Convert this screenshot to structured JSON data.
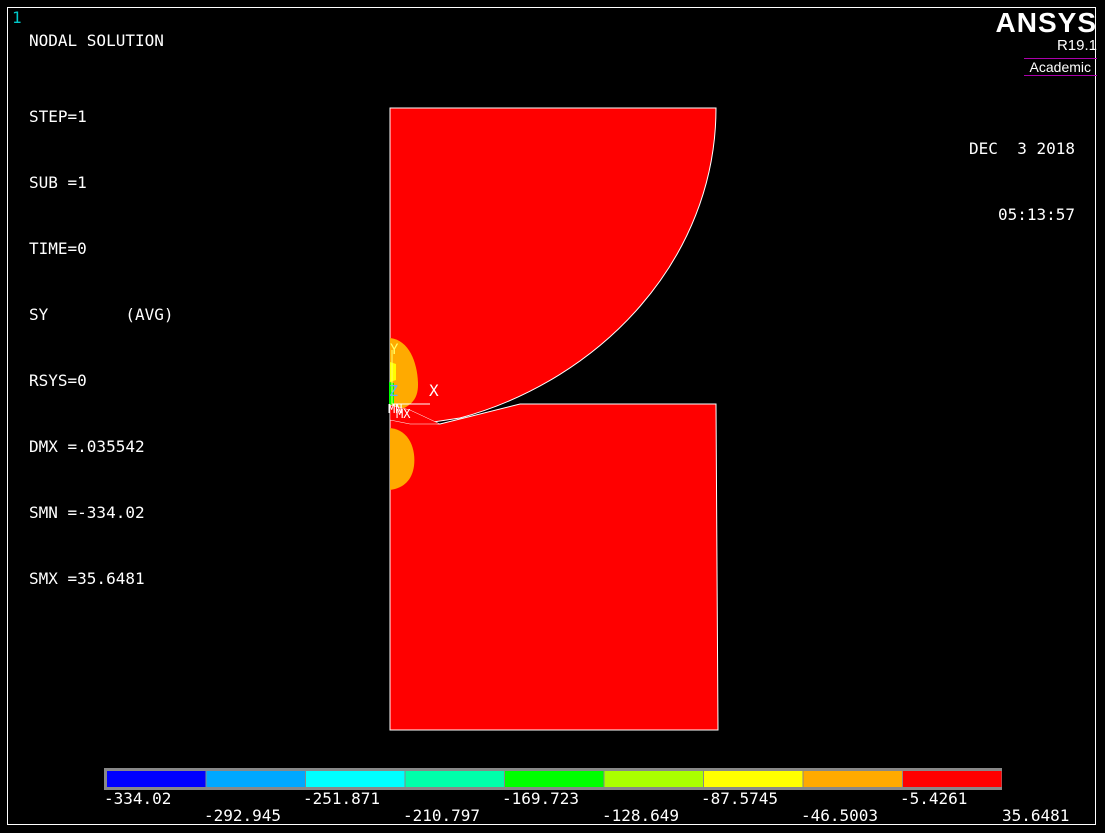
{
  "window_number": "1",
  "header": {
    "title": "NODAL SOLUTION",
    "lines": [
      "STEP=1",
      "SUB =1",
      "TIME=0",
      "SY        (AVG)",
      "RSYS=0",
      "DMX =.035542",
      "SMN =-334.02",
      "SMX =35.6481"
    ]
  },
  "logo": {
    "brand": "ANSYS",
    "version": "R19.1",
    "edition": "Academic"
  },
  "datetime": {
    "date": "DEC  3 2018",
    "time": "05:13:57"
  },
  "triad": {
    "y": "Y",
    "z": "Z",
    "x": "X",
    "mn": "MN",
    "mx": "MX"
  },
  "colors": {
    "contour": [
      "#0000ff",
      "#00a8ff",
      "#00ffff",
      "#00ffaa",
      "#00ff00",
      "#aaff00",
      "#ffff00",
      "#ffaa00",
      "#ff0000"
    ]
  },
  "legend": {
    "upper_labels": [
      "-334.02",
      "-251.871",
      "-169.723",
      "-87.5745",
      "-5.4261"
    ],
    "lower_labels": [
      "-292.945",
      "-210.797",
      "-128.649",
      "-46.5003",
      "35.6481"
    ]
  }
}
